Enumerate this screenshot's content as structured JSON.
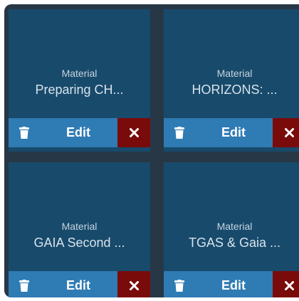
{
  "cards": [
    {
      "type": "Material",
      "title": "Preparing CH...",
      "edit_label": "Edit"
    },
    {
      "type": "Material",
      "title": "HORIZONS: ...",
      "edit_label": "Edit"
    },
    {
      "type": "Material",
      "title": "GAIA Second ...",
      "edit_label": "Edit"
    },
    {
      "type": "Material",
      "title": "TGAS & Gaia ...",
      "edit_label": "Edit"
    }
  ],
  "icons": {
    "delete": "trash-icon",
    "remove": "close-icon"
  },
  "colors": {
    "background": "#273746",
    "card": "#184a6b",
    "action_blue": "#2f7bb4",
    "action_red": "#7a0b0b"
  }
}
